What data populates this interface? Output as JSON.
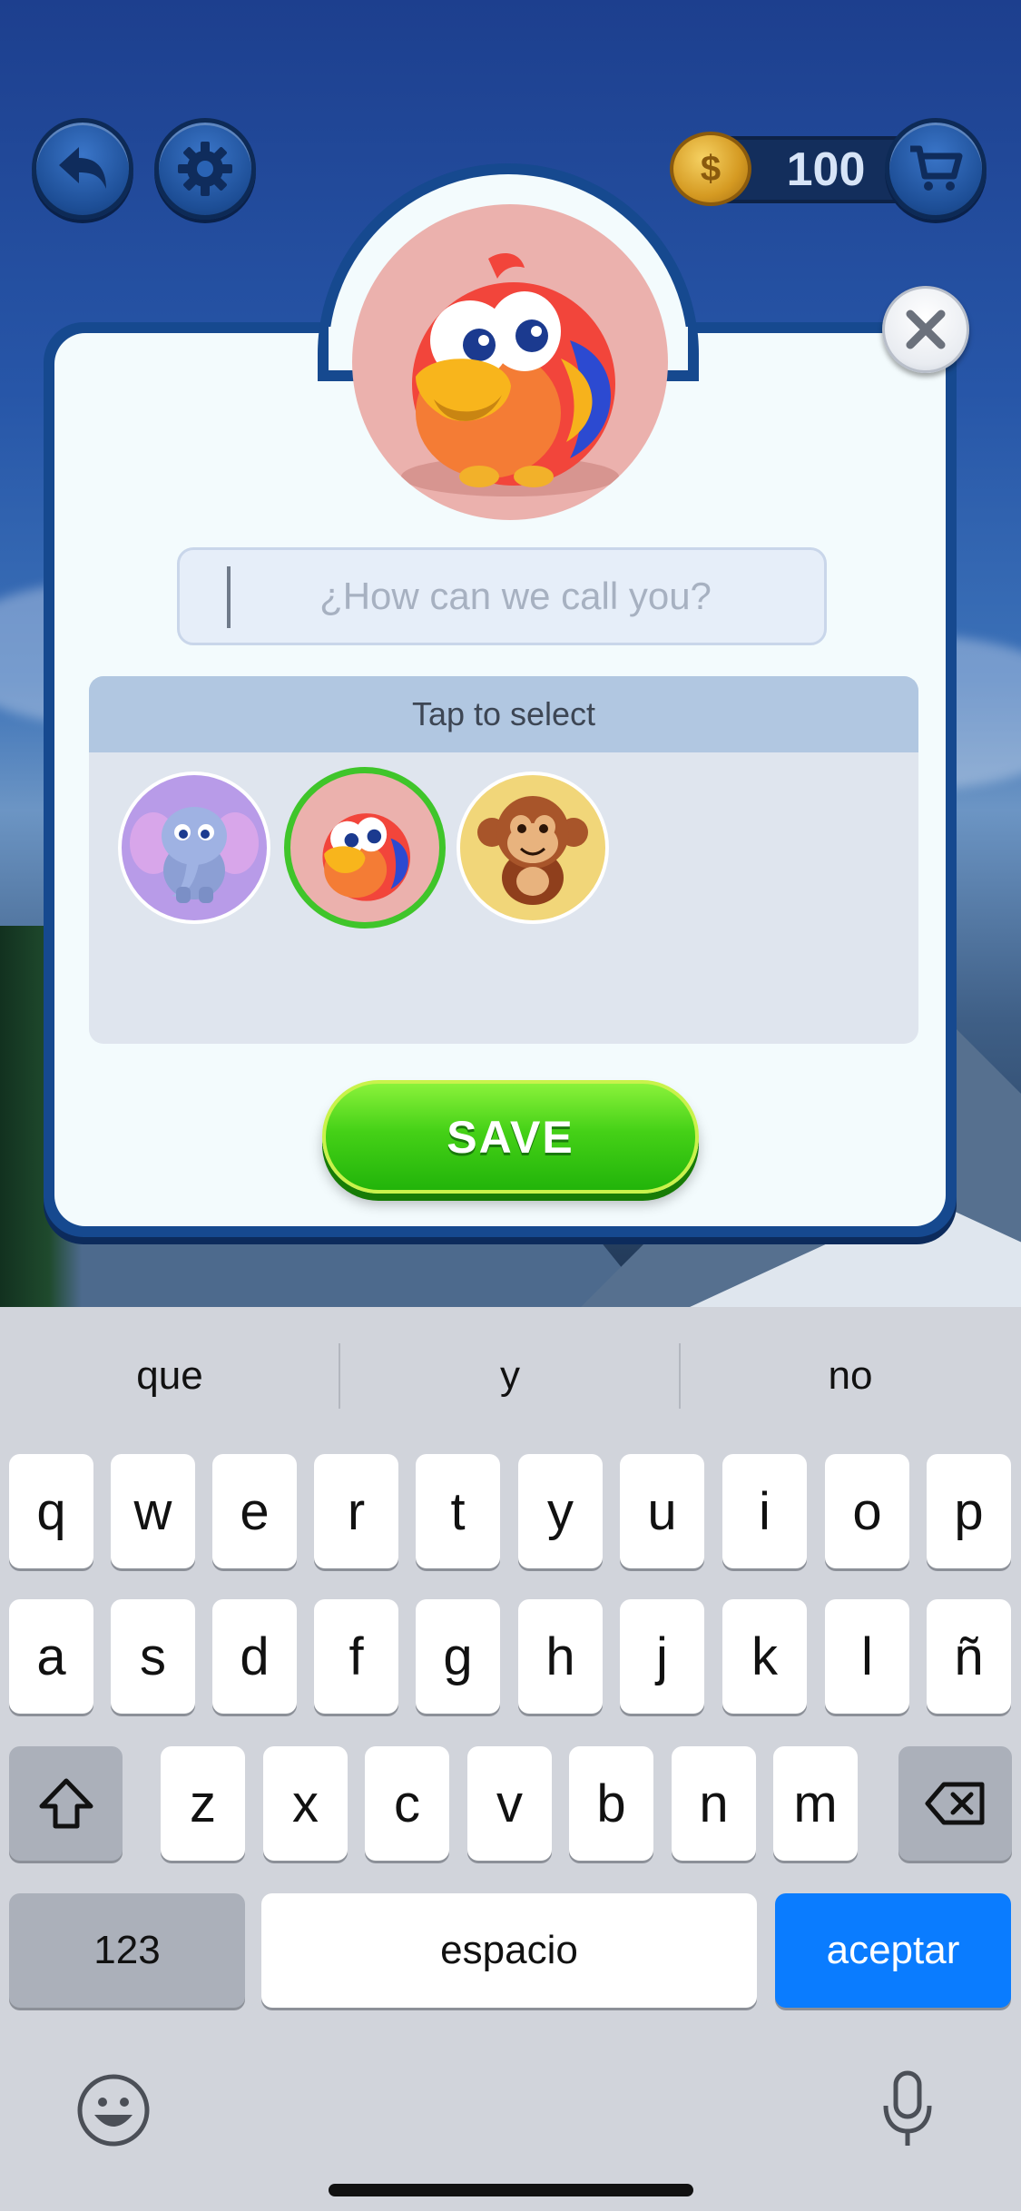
{
  "hud": {
    "back_icon": "back-arrow-icon",
    "settings_icon": "gear-icon",
    "coins": "100",
    "coin_icon": "coin-icon",
    "shop_icon": "cart-icon"
  },
  "dialog": {
    "selected_avatar": "parrot",
    "close_icon": "close-icon",
    "name_input": {
      "value": "",
      "placeholder": "¿How can we call you?"
    },
    "select_header": "Tap to select",
    "avatars": [
      {
        "id": "elephant",
        "selected": false,
        "bg": "#b89be8"
      },
      {
        "id": "parrot",
        "selected": true,
        "bg": "#ebb1ad"
      },
      {
        "id": "monkey",
        "selected": false,
        "bg": "#f1d679"
      }
    ],
    "save_label": "SAVE"
  },
  "keyboard": {
    "suggestions": [
      "que",
      "y",
      "no"
    ],
    "row1": [
      "q",
      "w",
      "e",
      "r",
      "t",
      "y",
      "u",
      "i",
      "o",
      "p"
    ],
    "row2": [
      "a",
      "s",
      "d",
      "f",
      "g",
      "h",
      "j",
      "k",
      "l",
      "ñ"
    ],
    "row3": [
      "z",
      "x",
      "c",
      "v",
      "b",
      "n",
      "m"
    ],
    "numbers_label": "123",
    "space_label": "espacio",
    "return_label": "aceptar",
    "shift_icon": "shift-icon",
    "delete_icon": "backspace-icon",
    "emoji_icon": "emoji-icon",
    "mic_icon": "microphone-icon"
  }
}
